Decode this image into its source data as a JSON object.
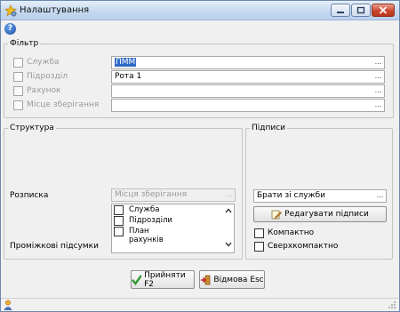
{
  "window": {
    "title": "Налаштування",
    "icons": {
      "title": "settings-star-icon",
      "help": "help-icon",
      "status": "user-icon"
    }
  },
  "toolbar": {
    "help_glyph": "?"
  },
  "filter": {
    "legend": "Фільтр",
    "rows": [
      {
        "label": "Служба",
        "value": "ПММ",
        "selected": true,
        "checked": false
      },
      {
        "label": "Підрозділ",
        "value": "Рота 1",
        "selected": false,
        "checked": false
      },
      {
        "label": "Рахунок",
        "value": "",
        "selected": false,
        "checked": false
      },
      {
        "label": "Місце зберігання",
        "value": "",
        "selected": false,
        "checked": false
      }
    ],
    "ellipsis": "..."
  },
  "structure": {
    "legend": "Структура",
    "receipt_label": "Розписка",
    "receipt_value": "Місця зберігання",
    "subtotals_label": "Проміжкові підсумки",
    "subtotal_options": [
      "Служба",
      "Підрозділи",
      "План рахунків"
    ]
  },
  "signatures": {
    "legend": "Підписи",
    "source_value": "Брати зі служби",
    "edit_button": "Редагувати підписи",
    "compact_label": "Компактно",
    "supercompact_label": "Сверхкомпактно"
  },
  "footer": {
    "accept_button": "Прийняти F2",
    "cancel_button": "Відмова Esc"
  }
}
